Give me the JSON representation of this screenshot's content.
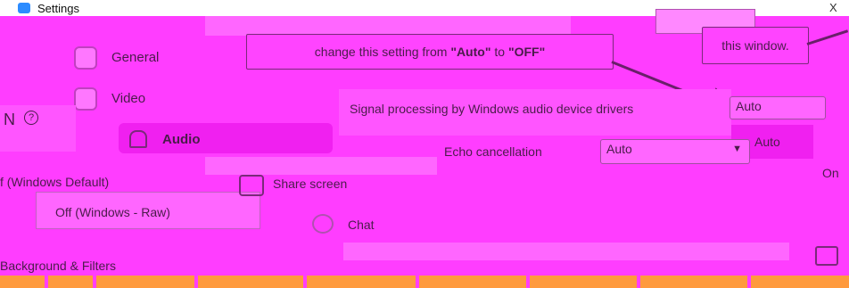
{
  "window": {
    "title": "Settings",
    "close_glyph": "X"
  },
  "sidebar": {
    "items": [
      {
        "label": "General",
        "icon": "gear-icon"
      },
      {
        "label": "Video",
        "icon": "video-icon"
      },
      {
        "label": "Audio",
        "icon": "headphone-icon"
      }
    ]
  },
  "callouts": {
    "main": {
      "prefix": "change this setting from ",
      "from": "\"Auto\"",
      "middle": " to ",
      "to": "\"OFF\""
    },
    "right": {
      "text": "this window."
    }
  },
  "settings": {
    "signal_processing": {
      "label": "Signal processing by Windows audio device drivers",
      "value": "Auto"
    },
    "auto_option": "Auto",
    "echo_cancellation": {
      "label": "Echo cancellation",
      "value": "Auto"
    },
    "on_text": "On"
  },
  "left_panel": {
    "label": "f (Windows Default)",
    "option": "Off (Windows - Raw)",
    "help_glyph": "?"
  },
  "labels": {
    "share_screen": "Share screen",
    "chat": "Chat",
    "background": "Background & Filters"
  },
  "colors": {
    "overlay": "#ff3dff",
    "accent": "#2d8cff",
    "strip": "#ff9a3d"
  }
}
